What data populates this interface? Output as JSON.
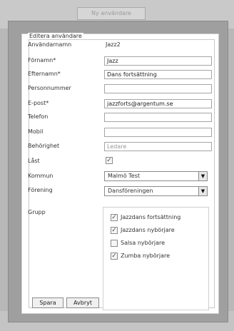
{
  "background": {
    "tab_label": "Ny användare"
  },
  "form": {
    "legend": "Editera användare",
    "username": {
      "label": "Användarnamn",
      "value": "Jazz2"
    },
    "fornamn": {
      "label": "Förnamn*",
      "value": "Jazz"
    },
    "efternamn": {
      "label": "Efternamn*",
      "value": "Dans fortsättning"
    },
    "personnummer": {
      "label": "Personnummer",
      "value": ""
    },
    "epost": {
      "label": "E-post*",
      "value": "jazzforts@argentum.se"
    },
    "telefon": {
      "label": "Telefon",
      "value": ""
    },
    "mobil": {
      "label": "Mobil",
      "value": ""
    },
    "behorighet": {
      "label": "Behörighet",
      "placeholder": "Ledare"
    },
    "last": {
      "label": "Låst",
      "checked": true
    },
    "kommun": {
      "label": "Kommun",
      "selected": "Malmö Test"
    },
    "forening": {
      "label": "Förening",
      "selected": "Dansföreningen"
    },
    "grupp": {
      "label": "Grupp",
      "items": [
        {
          "label": "Jazzdans fortsättning",
          "checked": true
        },
        {
          "label": "Jazzdans nybörjare",
          "checked": true
        },
        {
          "label": "Salsa nybörjare",
          "checked": false
        },
        {
          "label": "Zumba nybörjare",
          "checked": true
        }
      ]
    },
    "buttons": {
      "save": "Spara",
      "cancel": "Avbryt"
    }
  },
  "icons": {
    "check": "check-icon",
    "dropdown": "chevron-down-icon"
  }
}
